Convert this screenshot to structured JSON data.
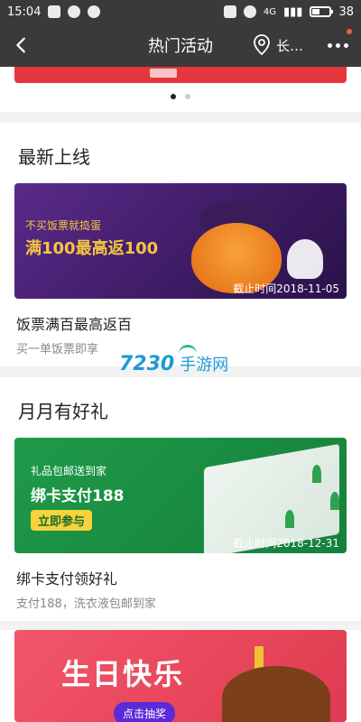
{
  "status_bar": {
    "time": "15:04",
    "network": "4G",
    "battery": "38",
    "battery_level": 0.38
  },
  "nav": {
    "title": "热门活动",
    "location": "长…"
  },
  "carousel": {
    "pages": 2,
    "active": 0
  },
  "sections": [
    {
      "title": "最新上线",
      "card": {
        "banner_tag": "不买饭票就捣蛋",
        "banner_big": "满100最高返100",
        "deadline": "截止时间2018-11-05",
        "title": "饭票满百最高返百",
        "subtitle": "买一单饭票即享"
      }
    },
    {
      "title": "月月有好礼",
      "card": {
        "banner_tag": "礼品包邮送到家",
        "banner_big": "绑卡支付188",
        "banner_button": "立即参与",
        "deadline": "截止时间2018-12-31",
        "title": "绑卡支付领好礼",
        "subtitle": "支付188，洗衣液包邮到家"
      }
    }
  ],
  "birthday_banner": {
    "big": "生日快乐",
    "pill": "点击抽奖"
  },
  "watermark": {
    "number": "7230",
    "text": "手游网"
  }
}
